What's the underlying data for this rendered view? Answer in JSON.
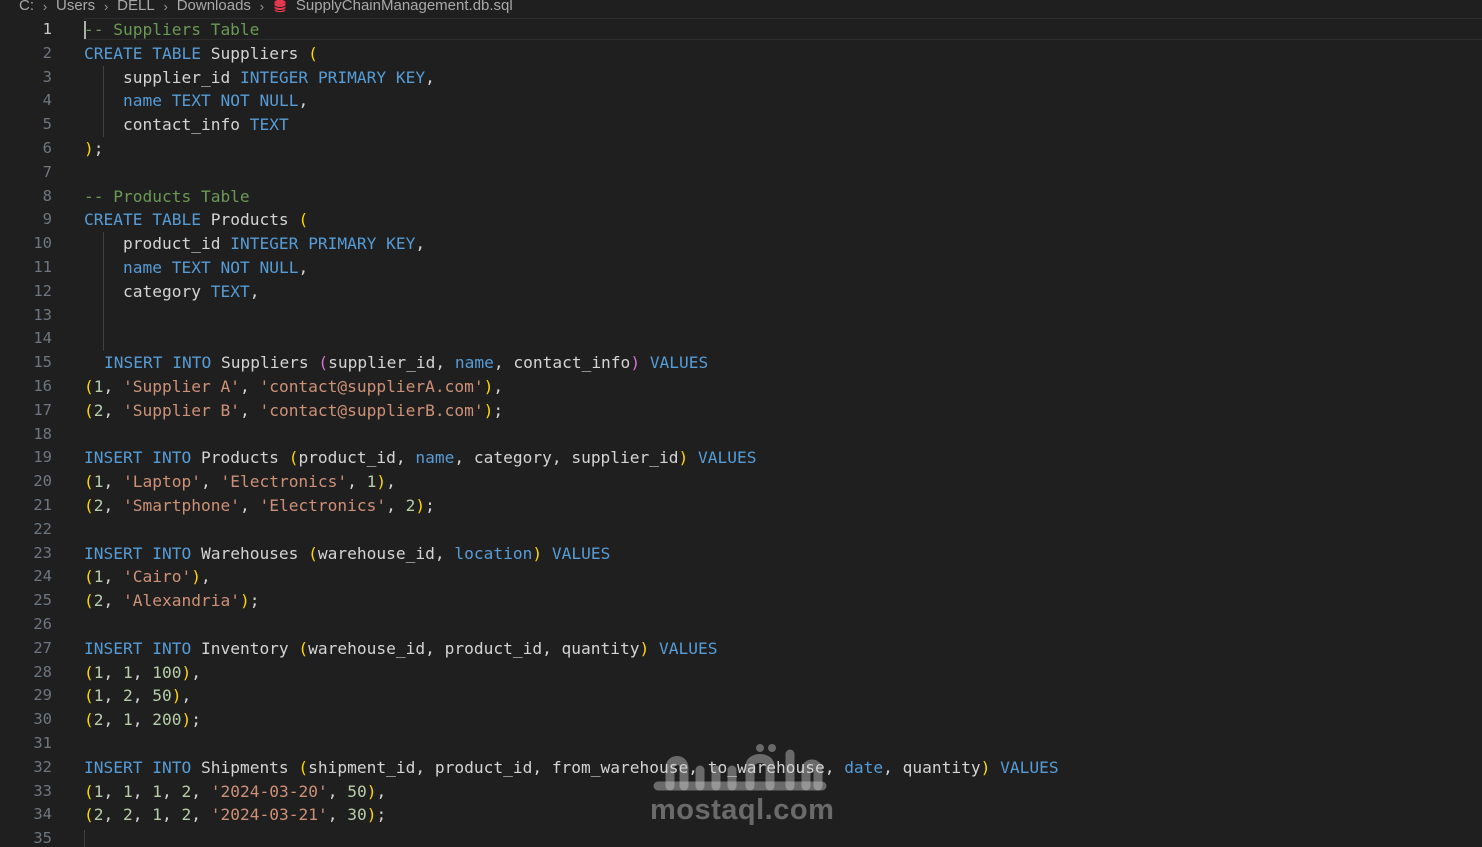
{
  "breadcrumb": {
    "items": [
      "C:",
      "Users",
      "DELL",
      "Downloads"
    ],
    "file": "SupplyChainManagement.db.sql",
    "separator": "›"
  },
  "editor": {
    "active_line": 1,
    "line_numbers": [
      "1",
      "2",
      "3",
      "4",
      "5",
      "6",
      "7",
      "8",
      "9",
      "10",
      "11",
      "12",
      "13",
      "14",
      "15",
      "16",
      "17",
      "18",
      "19",
      "20",
      "21",
      "22",
      "23",
      "24",
      "25",
      "26",
      "27",
      "28",
      "29",
      "30",
      "31",
      "32",
      "33",
      "34",
      "35"
    ],
    "lines": [
      {
        "indent": "none",
        "tokens": [
          {
            "t": "-- Suppliers Table",
            "c": "cm"
          }
        ]
      },
      {
        "indent": "none",
        "tokens": [
          {
            "t": "CREATE",
            "c": "kw"
          },
          {
            "t": " "
          },
          {
            "t": "TABLE",
            "c": "kw"
          },
          {
            "t": " Suppliers "
          },
          {
            "t": "(",
            "c": "par"
          }
        ]
      },
      {
        "indent": "guide",
        "tokens": [
          {
            "t": "supplier_id "
          },
          {
            "t": "INTEGER",
            "c": "kw"
          },
          {
            "t": " "
          },
          {
            "t": "PRIMARY",
            "c": "kw"
          },
          {
            "t": " "
          },
          {
            "t": "KEY",
            "c": "kw"
          },
          {
            "t": ","
          }
        ]
      },
      {
        "indent": "guide",
        "tokens": [
          {
            "t": "name",
            "c": "kw"
          },
          {
            "t": " "
          },
          {
            "t": "TEXT",
            "c": "kw"
          },
          {
            "t": " "
          },
          {
            "t": "NOT",
            "c": "kw"
          },
          {
            "t": " "
          },
          {
            "t": "NULL",
            "c": "kw"
          },
          {
            "t": ","
          }
        ]
      },
      {
        "indent": "guide",
        "tokens": [
          {
            "t": "contact_info "
          },
          {
            "t": "TEXT",
            "c": "kw"
          }
        ]
      },
      {
        "indent": "none",
        "tokens": [
          {
            "t": ")",
            "c": "par"
          },
          {
            "t": ";"
          }
        ]
      },
      {
        "indent": "none",
        "tokens": []
      },
      {
        "indent": "none",
        "tokens": [
          {
            "t": "-- Products Table",
            "c": "cm"
          }
        ]
      },
      {
        "indent": "none",
        "tokens": [
          {
            "t": "CREATE",
            "c": "kw"
          },
          {
            "t": " "
          },
          {
            "t": "TABLE",
            "c": "kw"
          },
          {
            "t": " Products "
          },
          {
            "t": "(",
            "c": "par"
          }
        ]
      },
      {
        "indent": "guide",
        "tokens": [
          {
            "t": "product_id "
          },
          {
            "t": "INTEGER",
            "c": "kw"
          },
          {
            "t": " "
          },
          {
            "t": "PRIMARY",
            "c": "kw"
          },
          {
            "t": " "
          },
          {
            "t": "KEY",
            "c": "kw"
          },
          {
            "t": ","
          }
        ]
      },
      {
        "indent": "guide",
        "tokens": [
          {
            "t": "name",
            "c": "kw"
          },
          {
            "t": " "
          },
          {
            "t": "TEXT",
            "c": "kw"
          },
          {
            "t": " "
          },
          {
            "t": "NOT",
            "c": "kw"
          },
          {
            "t": " "
          },
          {
            "t": "NULL",
            "c": "kw"
          },
          {
            "t": ","
          }
        ]
      },
      {
        "indent": "guide",
        "tokens": [
          {
            "t": "category "
          },
          {
            "t": "TEXT",
            "c": "kw"
          },
          {
            "t": ","
          }
        ]
      },
      {
        "indent": "guide",
        "tokens": []
      },
      {
        "indent": "guide",
        "tokens": []
      },
      {
        "indent": "ins",
        "tokens": [
          {
            "t": "INSERT",
            "c": "kw"
          },
          {
            "t": " "
          },
          {
            "t": "INTO",
            "c": "kw"
          },
          {
            "t": " Suppliers "
          },
          {
            "t": "(",
            "c": "pur"
          },
          {
            "t": "supplier_id, "
          },
          {
            "t": "name",
            "c": "kw"
          },
          {
            "t": ", contact_info"
          },
          {
            "t": ")",
            "c": "pur"
          },
          {
            "t": " "
          },
          {
            "t": "VALUES",
            "c": "kw"
          }
        ]
      },
      {
        "indent": "none",
        "tokens": [
          {
            "t": "(",
            "c": "par"
          },
          {
            "t": "1",
            "c": "num"
          },
          {
            "t": ", "
          },
          {
            "t": "'Supplier A'",
            "c": "str"
          },
          {
            "t": ", "
          },
          {
            "t": "'contact@supplierA.com'",
            "c": "str"
          },
          {
            "t": ")",
            "c": "par"
          },
          {
            "t": ","
          }
        ]
      },
      {
        "indent": "none",
        "tokens": [
          {
            "t": "(",
            "c": "par"
          },
          {
            "t": "2",
            "c": "num"
          },
          {
            "t": ", "
          },
          {
            "t": "'Supplier B'",
            "c": "str"
          },
          {
            "t": ", "
          },
          {
            "t": "'contact@supplierB.com'",
            "c": "str"
          },
          {
            "t": ")",
            "c": "par"
          },
          {
            "t": ";"
          }
        ]
      },
      {
        "indent": "none",
        "tokens": []
      },
      {
        "indent": "none",
        "tokens": [
          {
            "t": "INSERT",
            "c": "kw"
          },
          {
            "t": " "
          },
          {
            "t": "INTO",
            "c": "kw"
          },
          {
            "t": " Products "
          },
          {
            "t": "(",
            "c": "par"
          },
          {
            "t": "product_id, "
          },
          {
            "t": "name",
            "c": "kw"
          },
          {
            "t": ", category, supplier_id"
          },
          {
            "t": ")",
            "c": "par"
          },
          {
            "t": " "
          },
          {
            "t": "VALUES",
            "c": "kw"
          }
        ]
      },
      {
        "indent": "none",
        "tokens": [
          {
            "t": "(",
            "c": "par"
          },
          {
            "t": "1",
            "c": "num"
          },
          {
            "t": ", "
          },
          {
            "t": "'Laptop'",
            "c": "str"
          },
          {
            "t": ", "
          },
          {
            "t": "'Electronics'",
            "c": "str"
          },
          {
            "t": ", "
          },
          {
            "t": "1",
            "c": "num"
          },
          {
            "t": ")",
            "c": "par"
          },
          {
            "t": ","
          }
        ]
      },
      {
        "indent": "none",
        "tokens": [
          {
            "t": "(",
            "c": "par"
          },
          {
            "t": "2",
            "c": "num"
          },
          {
            "t": ", "
          },
          {
            "t": "'Smartphone'",
            "c": "str"
          },
          {
            "t": ", "
          },
          {
            "t": "'Electronics'",
            "c": "str"
          },
          {
            "t": ", "
          },
          {
            "t": "2",
            "c": "num"
          },
          {
            "t": ")",
            "c": "par"
          },
          {
            "t": ";"
          }
        ]
      },
      {
        "indent": "none",
        "tokens": []
      },
      {
        "indent": "none",
        "tokens": [
          {
            "t": "INSERT",
            "c": "kw"
          },
          {
            "t": " "
          },
          {
            "t": "INTO",
            "c": "kw"
          },
          {
            "t": " Warehouses "
          },
          {
            "t": "(",
            "c": "par"
          },
          {
            "t": "warehouse_id, "
          },
          {
            "t": "location",
            "c": "kw"
          },
          {
            "t": ")",
            "c": "par"
          },
          {
            "t": " "
          },
          {
            "t": "VALUES",
            "c": "kw"
          }
        ]
      },
      {
        "indent": "none",
        "tokens": [
          {
            "t": "(",
            "c": "par"
          },
          {
            "t": "1",
            "c": "num"
          },
          {
            "t": ", "
          },
          {
            "t": "'Cairo'",
            "c": "str"
          },
          {
            "t": ")",
            "c": "par"
          },
          {
            "t": ","
          }
        ]
      },
      {
        "indent": "none",
        "tokens": [
          {
            "t": "(",
            "c": "par"
          },
          {
            "t": "2",
            "c": "num"
          },
          {
            "t": ", "
          },
          {
            "t": "'Alexandria'",
            "c": "str"
          },
          {
            "t": ")",
            "c": "par"
          },
          {
            "t": ";"
          }
        ]
      },
      {
        "indent": "none",
        "tokens": []
      },
      {
        "indent": "none",
        "tokens": [
          {
            "t": "INSERT",
            "c": "kw"
          },
          {
            "t": " "
          },
          {
            "t": "INTO",
            "c": "kw"
          },
          {
            "t": " Inventory "
          },
          {
            "t": "(",
            "c": "par"
          },
          {
            "t": "warehouse_id, product_id, quantity"
          },
          {
            "t": ")",
            "c": "par"
          },
          {
            "t": " "
          },
          {
            "t": "VALUES",
            "c": "kw"
          }
        ]
      },
      {
        "indent": "none",
        "tokens": [
          {
            "t": "(",
            "c": "par"
          },
          {
            "t": "1",
            "c": "num"
          },
          {
            "t": ", "
          },
          {
            "t": "1",
            "c": "num"
          },
          {
            "t": ", "
          },
          {
            "t": "100",
            "c": "num"
          },
          {
            "t": ")",
            "c": "par"
          },
          {
            "t": ","
          }
        ]
      },
      {
        "indent": "none",
        "tokens": [
          {
            "t": "(",
            "c": "par"
          },
          {
            "t": "1",
            "c": "num"
          },
          {
            "t": ", "
          },
          {
            "t": "2",
            "c": "num"
          },
          {
            "t": ", "
          },
          {
            "t": "50",
            "c": "num"
          },
          {
            "t": ")",
            "c": "par"
          },
          {
            "t": ","
          }
        ]
      },
      {
        "indent": "none",
        "tokens": [
          {
            "t": "(",
            "c": "par"
          },
          {
            "t": "2",
            "c": "num"
          },
          {
            "t": ", "
          },
          {
            "t": "1",
            "c": "num"
          },
          {
            "t": ", "
          },
          {
            "t": "200",
            "c": "num"
          },
          {
            "t": ")",
            "c": "par"
          },
          {
            "t": ";"
          }
        ]
      },
      {
        "indent": "none",
        "tokens": []
      },
      {
        "indent": "none",
        "tokens": [
          {
            "t": "INSERT",
            "c": "kw"
          },
          {
            "t": " "
          },
          {
            "t": "INTO",
            "c": "kw"
          },
          {
            "t": " Shipments "
          },
          {
            "t": "(",
            "c": "par"
          },
          {
            "t": "shipment_id, product_id, from_warehouse, to_warehouse, "
          },
          {
            "t": "date",
            "c": "kw"
          },
          {
            "t": ", quantity"
          },
          {
            "t": ")",
            "c": "par"
          },
          {
            "t": " "
          },
          {
            "t": "VALUES",
            "c": "kw"
          }
        ]
      },
      {
        "indent": "none",
        "tokens": [
          {
            "t": "(",
            "c": "par"
          },
          {
            "t": "1",
            "c": "num"
          },
          {
            "t": ", "
          },
          {
            "t": "1",
            "c": "num"
          },
          {
            "t": ", "
          },
          {
            "t": "1",
            "c": "num"
          },
          {
            "t": ", "
          },
          {
            "t": "2",
            "c": "num"
          },
          {
            "t": ", "
          },
          {
            "t": "'2024-03-20'",
            "c": "str"
          },
          {
            "t": ", "
          },
          {
            "t": "50",
            "c": "num"
          },
          {
            "t": ")",
            "c": "par"
          },
          {
            "t": ","
          }
        ]
      },
      {
        "indent": "none",
        "tokens": [
          {
            "t": "(",
            "c": "par"
          },
          {
            "t": "2",
            "c": "num"
          },
          {
            "t": ", "
          },
          {
            "t": "2",
            "c": "num"
          },
          {
            "t": ", "
          },
          {
            "t": "1",
            "c": "num"
          },
          {
            "t": ", "
          },
          {
            "t": "2",
            "c": "num"
          },
          {
            "t": ", "
          },
          {
            "t": "'2024-03-21'",
            "c": "str"
          },
          {
            "t": ", "
          },
          {
            "t": "30",
            "c": "num"
          },
          {
            "t": ")",
            "c": "par"
          },
          {
            "t": ";"
          }
        ]
      },
      {
        "indent": "none",
        "tokens": []
      }
    ]
  },
  "watermark": {
    "latin": "mostaql.com",
    "arabic": "مستقل"
  },
  "colors": {
    "background": "#1f1f1f",
    "keyword": "#569cd6",
    "comment": "#6a9955",
    "string": "#ce9178",
    "number": "#b5cea8",
    "bracket_gold": "#ffd700",
    "bracket_purple": "#da70d6",
    "file_icon": "#e8384f"
  }
}
